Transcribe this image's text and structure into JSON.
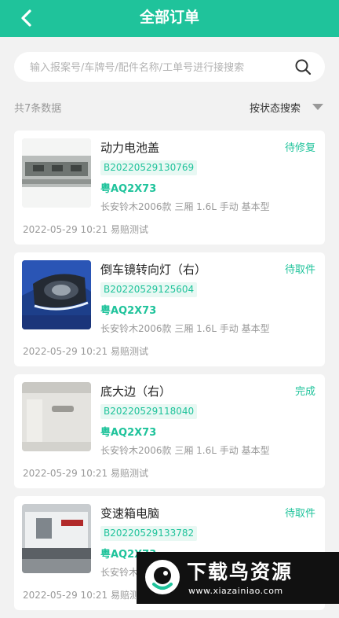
{
  "header": {
    "title": "全部订单",
    "back_icon": "chevron-left-icon"
  },
  "search": {
    "placeholder": "输入报案号/车牌号/配件名称/工单号进行接搜索",
    "icon": "search-icon"
  },
  "summary": {
    "count_text": "共7条数据",
    "filter_label": "按状态搜索"
  },
  "colors": {
    "accent": "#1fc39b",
    "background": "#f2f2f2"
  },
  "orders": [
    {
      "part_name": "动力电池盖",
      "status": "待修复",
      "order_no": "B20220529130769",
      "plate": "粤AQ2X73",
      "model": "长安铃木2006款 三厢 1.6L 手动 基本型",
      "date": "2022-05-29 10:21 易赔测试"
    },
    {
      "part_name": "倒车镜转向灯（右）",
      "status": "待取件",
      "order_no": "B20220529125604",
      "plate": "粤AQ2X73",
      "model": "长安铃木2006款 三厢 1.6L 手动 基本型",
      "date": "2022-05-29 10:21 易赔测试"
    },
    {
      "part_name": "底大边（右）",
      "status": "完成",
      "order_no": "B20220529118040",
      "plate": "粤AQ2X73",
      "model": "长安铃木2006款 三厢 1.6L 手动 基本型",
      "date": "2022-05-29 10:21 易赔测试"
    },
    {
      "part_name": "变速箱电脑",
      "status": "待取件",
      "order_no": "B20220529133782",
      "plate": "粤AQ2X73",
      "model": "长安铃木2006款 三厢 1.6L 手动 基本型",
      "date": "2022-05-29 10:21 易赔测试"
    }
  ],
  "watermark": {
    "title": "下载鸟资源",
    "url": "www.xiazainiao.com"
  }
}
